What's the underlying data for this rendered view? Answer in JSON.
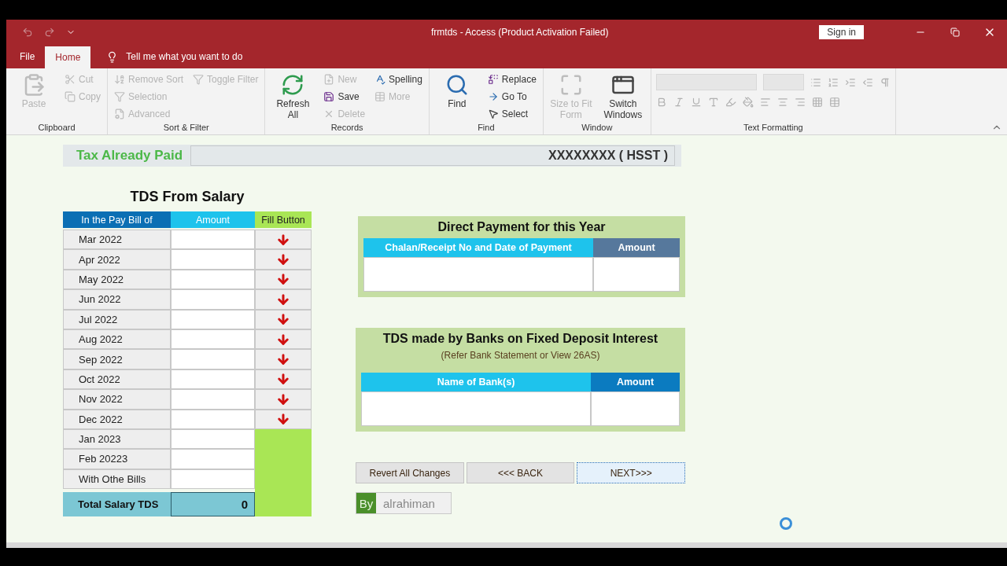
{
  "window": {
    "title": "frmtds  -  Access (Product Activation Failed)",
    "sign_in": "Sign in"
  },
  "ribbon_tabs": [
    {
      "label": "File",
      "selected": false
    },
    {
      "label": "Home",
      "selected": true
    }
  ],
  "tell_me": "Tell me what you want to do",
  "ribbon_groups": [
    {
      "label": "Clipboard",
      "kind": "buttons",
      "columns": [
        [
          {
            "label": "Paste",
            "kind": "large",
            "disabled": true
          }
        ],
        [
          {
            "label": "Cut",
            "kind": "small",
            "disabled": true
          },
          {
            "label": "Copy",
            "kind": "small",
            "disabled": true
          }
        ]
      ]
    },
    {
      "label": "Sort & Filter",
      "kind": "buttons",
      "columns": [
        [
          {
            "label": "Remove Sort",
            "kind": "small",
            "disabled": true
          },
          {
            "label": "Selection",
            "kind": "small",
            "disabled": true
          },
          {
            "label": "Advanced",
            "kind": "small",
            "disabled": true
          }
        ],
        [
          {
            "label": "Toggle Filter",
            "kind": "small",
            "disabled": true
          }
        ]
      ]
    },
    {
      "label": "Records",
      "kind": "buttons",
      "columns": [
        [
          {
            "label": "Refresh All",
            "kind": "large",
            "disabled": false
          }
        ],
        [
          {
            "label": "New",
            "kind": "small",
            "disabled": true
          },
          {
            "label": "Save",
            "kind": "small",
            "disabled": false
          },
          {
            "label": "Delete",
            "kind": "small",
            "disabled": true
          }
        ],
        [
          {
            "label": "Spelling",
            "kind": "small",
            "disabled": false
          },
          {
            "label": "More",
            "kind": "small",
            "disabled": true
          }
        ]
      ]
    },
    {
      "label": "Find",
      "kind": "buttons",
      "columns": [
        [
          {
            "label": "Find",
            "kind": "large",
            "disabled": false
          }
        ],
        [
          {
            "label": "Replace",
            "kind": "small",
            "disabled": false
          },
          {
            "label": "Go To",
            "kind": "small",
            "disabled": false
          },
          {
            "label": "Select",
            "kind": "small",
            "disabled": false
          }
        ]
      ]
    },
    {
      "label": "Window",
      "kind": "buttons",
      "columns": [
        [
          {
            "label": "Size to Fit Form",
            "kind": "large",
            "disabled": true
          }
        ],
        [
          {
            "label": "Switch Windows",
            "kind": "large",
            "disabled": false
          }
        ]
      ]
    },
    {
      "label": "Text Formatting",
      "kind": "formatting"
    }
  ],
  "tax_already_paid": {
    "label": "Tax Already Paid",
    "value": "XXXXXXXX ( HSST )"
  },
  "salary": {
    "title": "TDS From Salary",
    "columns": [
      "In the Pay Bill of",
      "Amount",
      "Fill Button"
    ],
    "rows": [
      {
        "label": "Mar 2022",
        "fill_button": true
      },
      {
        "label": "Apr 2022",
        "fill_button": true
      },
      {
        "label": "May 2022",
        "fill_button": true
      },
      {
        "label": "Jun 2022",
        "fill_button": true
      },
      {
        "label": "Jul 2022",
        "fill_button": true
      },
      {
        "label": "Aug 2022",
        "fill_button": true
      },
      {
        "label": "Sep 2022",
        "fill_button": true
      },
      {
        "label": "Oct 2022",
        "fill_button": true
      },
      {
        "label": "Nov 2022",
        "fill_button": true
      },
      {
        "label": "Dec 2022",
        "fill_button": true
      },
      {
        "label": "Jan 2023",
        "fill_button": false
      },
      {
        "label": "Feb 20223",
        "fill_button": false
      },
      {
        "label": "With Othe Bills",
        "fill_button": false
      }
    ],
    "total": {
      "label": "Total Salary TDS",
      "value": "0"
    }
  },
  "direct_payment": {
    "title": "Direct Payment for this Year",
    "columns": [
      "Chalan/Receipt No and Date of Payment",
      "Amount"
    ]
  },
  "bank_tds": {
    "title": "TDS made by Banks on Fixed Deposit Interest",
    "subtitle": "(Refer Bank Statement or View 26AS)",
    "columns": [
      "Name of Bank(s)",
      "Amount"
    ]
  },
  "buttons": [
    {
      "label": "Revert All Changes",
      "focused": false
    },
    {
      "label": "<<< BACK",
      "focused": false
    },
    {
      "label": "NEXT>>>",
      "focused": true
    }
  ],
  "credit": {
    "by": "By",
    "name": "alrahiman"
  }
}
